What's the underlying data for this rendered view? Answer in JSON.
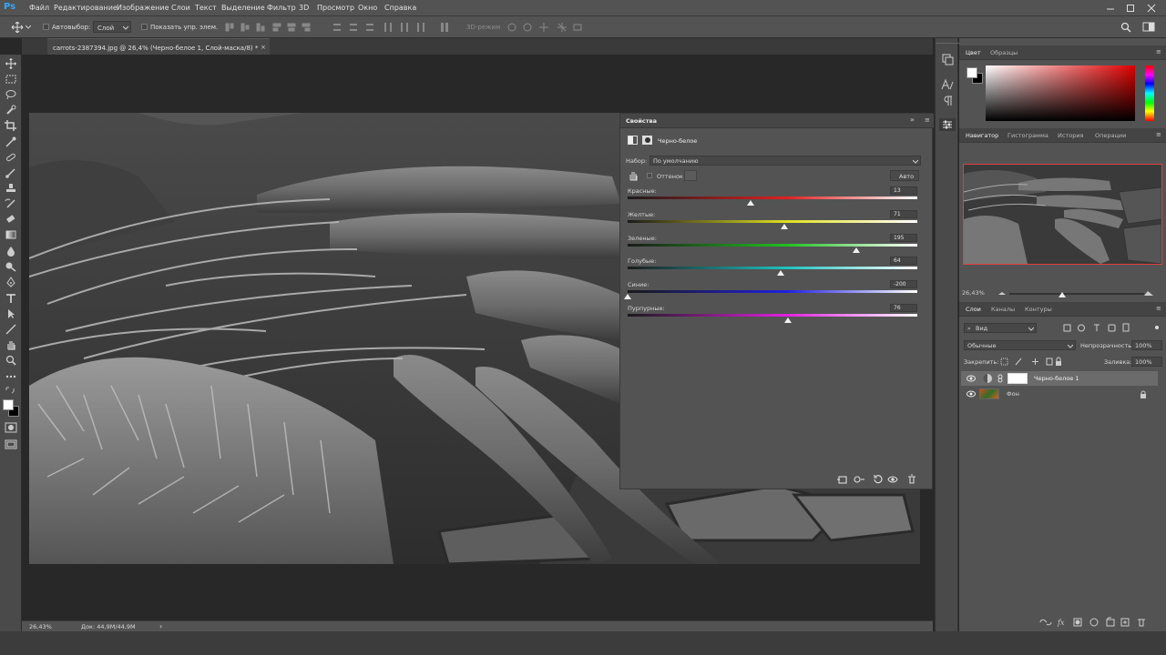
{
  "app": {
    "logo": "Ps"
  },
  "menu": [
    "Файл",
    "Редактирование",
    "Изображение",
    "Слои",
    "Текст",
    "Выделение",
    "Фильтр",
    "3D",
    "Просмотр",
    "Окно",
    "Справка"
  ],
  "options": {
    "autoselect_label": "Автовыбор:",
    "autoselect_value": "Слой",
    "show_controls_label": "Показать упр. элем.",
    "mode_3d": "3D-режим"
  },
  "document": {
    "tab_title": "carrots-2387394.jpg @ 26,4% (Черно-белое 1, Слой-маска/8) *"
  },
  "status": {
    "zoom": "26,43%",
    "doc_info": "Док: 44,9M/44,9M"
  },
  "properties": {
    "title": "Свойства",
    "adjustment_name": "Черно-белое",
    "preset_label": "Набор:",
    "preset_value": "По умолчанию",
    "tint_label": "Оттенок",
    "tint_checked": false,
    "auto_button": "Авто",
    "sliders": [
      {
        "label": "Красные:",
        "value": "13",
        "color": "#e02020"
      },
      {
        "label": "Желтые:",
        "value": "71",
        "color": "#e0e020"
      },
      {
        "label": "Зеленые:",
        "value": "195",
        "color": "#20c020"
      },
      {
        "label": "Голубые:",
        "value": "64",
        "color": "#20c0c0"
      },
      {
        "label": "Синие:",
        "value": "-200",
        "color": "#2020e0"
      },
      {
        "label": "Пурпурные:",
        "value": "76",
        "color": "#e020e0"
      }
    ],
    "slider_range": [
      -200,
      300
    ]
  },
  "color_panel": {
    "tabs": [
      "Цвет",
      "Образцы"
    ],
    "active": 0
  },
  "navigator_panel": {
    "tabs": [
      "Навигатор",
      "Гистограмма",
      "История",
      "Операции"
    ],
    "active": 0,
    "zoom": "26,43%"
  },
  "layers_panel": {
    "tabs": [
      "Слои",
      "Каналы",
      "Контуры"
    ],
    "active": 0,
    "filter_label": "Вид",
    "blend_mode": "Обычные",
    "opacity_label": "Непрозрачность:",
    "opacity_value": "100%",
    "lock_label": "Закрепить:",
    "fill_label": "Заливка:",
    "fill_value": "100%",
    "layers": [
      {
        "name": "Черно-белое 1",
        "visible": true,
        "selected": true
      },
      {
        "name": "Фон",
        "visible": true,
        "locked": true
      }
    ]
  }
}
